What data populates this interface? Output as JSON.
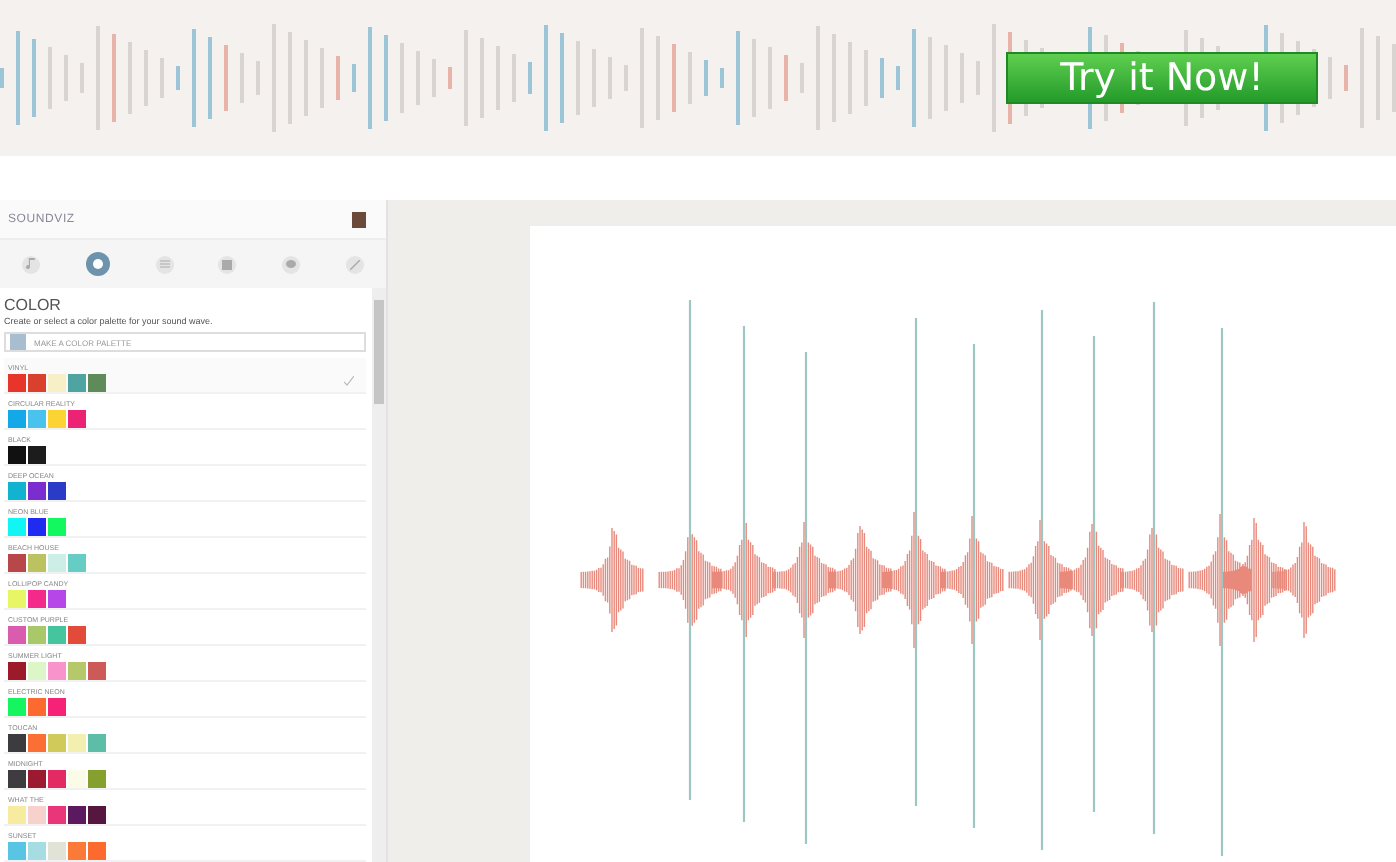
{
  "banner": {
    "button": "Try it Now!"
  },
  "app": {
    "logo": "SOUNDVIZ",
    "tabs": [
      {
        "kind": "music",
        "selected": false
      },
      {
        "kind": "color",
        "selected": true
      },
      {
        "kind": "list",
        "selected": false
      },
      {
        "kind": "image",
        "selected": false
      },
      {
        "kind": "chat",
        "selected": false
      },
      {
        "kind": "pen",
        "selected": false
      }
    ]
  },
  "panel": {
    "title": "COLOR",
    "description": "Create or select a color palette for your sound wave.",
    "new_palette": "MAKE A COLOR PALETTE"
  },
  "palettes": [
    {
      "name": "VINYL",
      "selected": true,
      "swatches": [
        {
          "color": "#e8352b"
        },
        {
          "color": "#d9402e"
        },
        {
          "color": "#f6efc8"
        },
        {
          "color": "#4fa3a0"
        },
        {
          "color": "#5f8a5a"
        }
      ]
    },
    {
      "name": "CIRCULAR REALITY",
      "selected": false,
      "swatches": [
        {
          "color": "#13a9e8"
        },
        {
          "color": "#49c2ee"
        },
        {
          "color": "#fbd433"
        },
        {
          "color": "#ec2374"
        }
      ]
    },
    {
      "name": "BLACK",
      "selected": false,
      "swatches": [
        {
          "color": "#111111"
        },
        {
          "color": "#1c1c1c"
        }
      ]
    },
    {
      "name": "DEEP OCEAN",
      "selected": false,
      "swatches": [
        {
          "color": "#12b3d0"
        },
        {
          "color": "#7a2ecf"
        },
        {
          "color": "#2a3bc8"
        }
      ]
    },
    {
      "name": "NEON BLUE",
      "selected": false,
      "swatches": [
        {
          "color": "#11f5f5"
        },
        {
          "color": "#1f2bf0"
        },
        {
          "color": "#12f85e"
        }
      ]
    },
    {
      "name": "BEACH HOUSE",
      "selected": false,
      "swatches": [
        {
          "color": "#b8474a"
        },
        {
          "color": "#bcc260"
        },
        {
          "color": "#cdeee6"
        },
        {
          "color": "#66cdc4"
        }
      ]
    },
    {
      "name": "LOLLIPOP CANDY",
      "selected": false,
      "swatches": [
        {
          "color": "#e8f565"
        },
        {
          "color": "#f42a8a"
        },
        {
          "color": "#b646e8"
        }
      ]
    },
    {
      "name": "CUSTOM PURPLE",
      "selected": false,
      "swatches": [
        {
          "color": "#d95cae"
        },
        {
          "color": "#a8c86a"
        },
        {
          "color": "#45c59e"
        },
        {
          "color": "#e24a3a"
        }
      ]
    },
    {
      "name": "SUMMER LIGHT",
      "selected": false,
      "swatches": [
        {
          "color": "#9b1b2a"
        },
        {
          "color": "#ddf6c8"
        },
        {
          "color": "#f993cc"
        },
        {
          "color": "#b5c96a"
        },
        {
          "color": "#cc5a58"
        }
      ]
    },
    {
      "name": "ELECTRIC NEON",
      "selected": false,
      "swatches": [
        {
          "color": "#15f560"
        },
        {
          "color": "#fc6a2f"
        },
        {
          "color": "#f52278"
        }
      ]
    },
    {
      "name": "TOUCAN",
      "selected": false,
      "swatches": [
        {
          "color": "#3c3b3d"
        },
        {
          "color": "#fc6f34"
        },
        {
          "color": "#cfca5a"
        },
        {
          "color": "#f2efb1"
        },
        {
          "color": "#5cbea6"
        }
      ]
    },
    {
      "name": "MIDNIGHT",
      "selected": false,
      "swatches": [
        {
          "color": "#3e3c3f"
        },
        {
          "color": "#9c1a2f"
        },
        {
          "color": "#e42a62"
        },
        {
          "color": "#fbfce8"
        },
        {
          "color": "#86a02d"
        }
      ]
    },
    {
      "name": "WHAT THE",
      "selected": false,
      "swatches": [
        {
          "color": "#f6eb9f"
        },
        {
          "color": "#f7d1cc"
        },
        {
          "color": "#e9357a"
        },
        {
          "color": "#5b1a60"
        },
        {
          "color": "#551640"
        }
      ]
    },
    {
      "name": "SUNSET",
      "selected": false,
      "swatches": [
        {
          "color": "#58c5e5"
        },
        {
          "color": "#a6dde3"
        },
        {
          "color": "#e1e3d6"
        },
        {
          "color": "#fb7a3a"
        },
        {
          "color": "#fd6a2e"
        }
      ]
    }
  ]
}
